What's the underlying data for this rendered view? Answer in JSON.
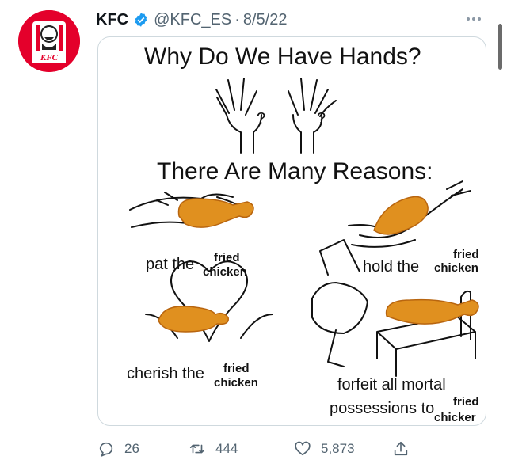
{
  "tweet": {
    "author_name": "KFC",
    "handle": "@KFC_ES",
    "separator": "·",
    "date": "8/5/22",
    "avatar_text": "KFC",
    "verified": true
  },
  "image": {
    "title": "Why Do We Have Hands?",
    "question_mark": "?",
    "subtitle": "There Are Many Reasons:",
    "panels": [
      {
        "verb": "pat the",
        "fried": "fried",
        "chicken": "chicken"
      },
      {
        "verb": "hold the",
        "fried": "fried",
        "chicken": "chicken"
      },
      {
        "verb": "cherish the",
        "fried": "fried",
        "chicken": "chicken"
      },
      {
        "verb_line1": "forfeit all mortal",
        "verb_line2": "possessions to",
        "fried": "fried",
        "chicken": "chicker"
      }
    ]
  },
  "actions": {
    "replies": "26",
    "retweets": "444",
    "likes": "5,873"
  },
  "colors": {
    "brand_red": "#e4002b",
    "verified_blue": "#1d9bf0",
    "muted": "#536471",
    "chicken": "#e0901f"
  }
}
